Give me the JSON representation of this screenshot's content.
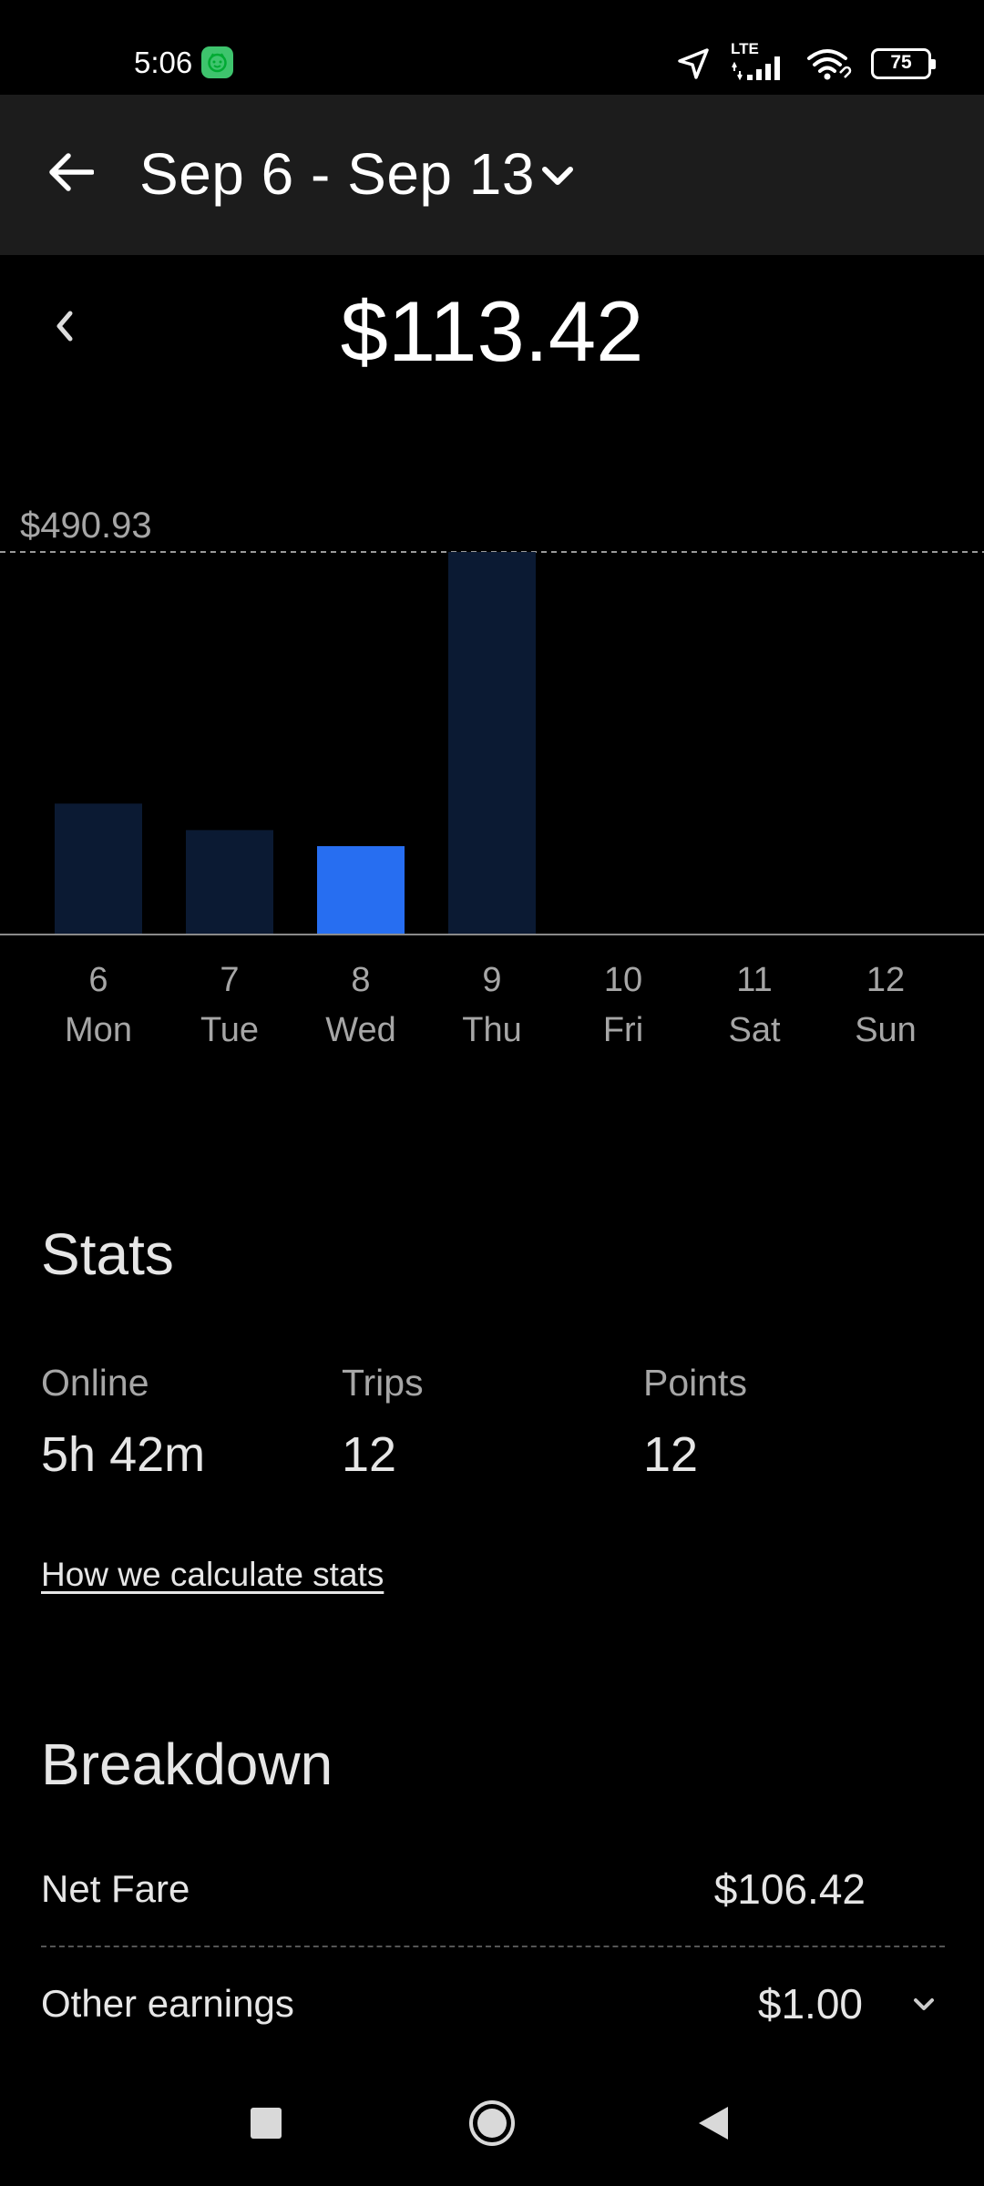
{
  "status_bar": {
    "time": "5:06",
    "network": "LTE",
    "battery": "75",
    "icons": [
      "app-notification-icon",
      "location-arrow-icon",
      "signal-icon",
      "wifi-icon",
      "battery-icon"
    ]
  },
  "header": {
    "date_range": "Sep 6 - Sep 13",
    "icons": [
      "back-arrow-icon",
      "chevron-down-icon"
    ]
  },
  "summary": {
    "total": "$113.42",
    "prev_icon": "chevron-left-icon"
  },
  "chart_data": {
    "type": "bar",
    "max_label": "$490.93",
    "ymax": 490.93,
    "days": [
      {
        "num": "6",
        "name": "Mon",
        "value": 168,
        "selected": false
      },
      {
        "num": "7",
        "name": "Tue",
        "value": 134,
        "selected": false
      },
      {
        "num": "8",
        "name": "Wed",
        "value": 113.42,
        "selected": true
      },
      {
        "num": "9",
        "name": "Thu",
        "value": 490.93,
        "selected": false
      },
      {
        "num": "10",
        "name": "Fri",
        "value": 0,
        "selected": false
      },
      {
        "num": "11",
        "name": "Sat",
        "value": 0,
        "selected": false
      },
      {
        "num": "12",
        "name": "Sun",
        "value": 0,
        "selected": false
      }
    ],
    "colors": {
      "bar": "#0b1a33",
      "selected": "#276ef1",
      "baseline": "#8a8a8a",
      "max_line": "#9a9a9a"
    }
  },
  "stats": {
    "title": "Stats",
    "online_label": "Online",
    "online_value": "5h 42m",
    "trips_label": "Trips",
    "trips_value": "12",
    "points_label": "Points",
    "points_value": "12",
    "link": "How we calculate stats"
  },
  "breakdown": {
    "title": "Breakdown",
    "net_fare_label": "Net Fare",
    "net_fare_value": "$106.42",
    "other_label": "Other earnings",
    "other_value": "$1.00"
  },
  "nav_bar": {
    "icons": [
      "recents-square-icon",
      "home-circle-icon",
      "back-triangle-icon"
    ]
  }
}
